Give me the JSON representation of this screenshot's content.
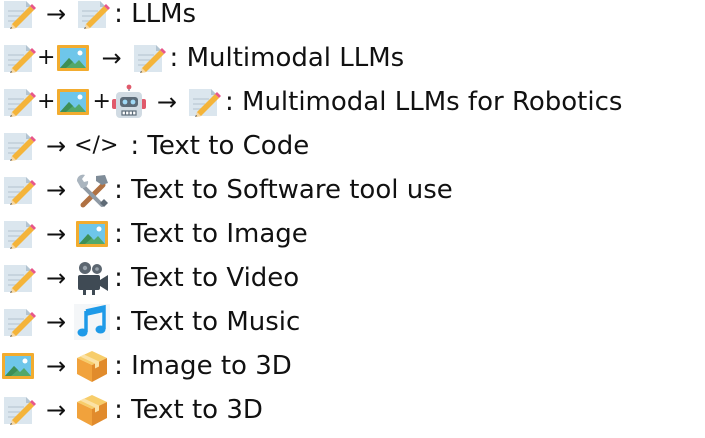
{
  "rows": [
    {
      "inputs": [
        "memo-icon"
      ],
      "output": {
        "type": "icon",
        "icon": "memo-icon"
      },
      "label": ": LLMs"
    },
    {
      "inputs": [
        "memo-icon",
        "picture-icon"
      ],
      "output": {
        "type": "icon",
        "icon": "memo-icon"
      },
      "label": ": Multimodal LLMs"
    },
    {
      "inputs": [
        "memo-icon",
        "picture-icon",
        "robot-icon"
      ],
      "output": {
        "type": "icon",
        "icon": "memo-icon"
      },
      "label": ": Multimodal LLMs for Robotics"
    },
    {
      "inputs": [
        "memo-icon"
      ],
      "output": {
        "type": "text",
        "text": "</>"
      },
      "label": ": Text to Code"
    },
    {
      "inputs": [
        "memo-icon"
      ],
      "output": {
        "type": "icon",
        "icon": "tools-icon"
      },
      "label": ": Text to Software tool use"
    },
    {
      "inputs": [
        "memo-icon"
      ],
      "output": {
        "type": "icon",
        "icon": "picture-icon"
      },
      "label": ": Text to Image"
    },
    {
      "inputs": [
        "memo-icon"
      ],
      "output": {
        "type": "icon",
        "icon": "movie-camera-icon"
      },
      "label": ": Text to Video"
    },
    {
      "inputs": [
        "memo-icon"
      ],
      "output": {
        "type": "icon",
        "icon": "music-note-icon"
      },
      "label": ": Text to Music"
    },
    {
      "inputs": [
        "picture-icon"
      ],
      "output": {
        "type": "icon",
        "icon": "package-icon"
      },
      "label": ": Image to 3D"
    },
    {
      "inputs": [
        "memo-icon"
      ],
      "output": {
        "type": "icon",
        "icon": "package-icon"
      },
      "label": ": Text to 3D"
    }
  ],
  "symbols": {
    "plus": "+",
    "arrow": "→"
  }
}
